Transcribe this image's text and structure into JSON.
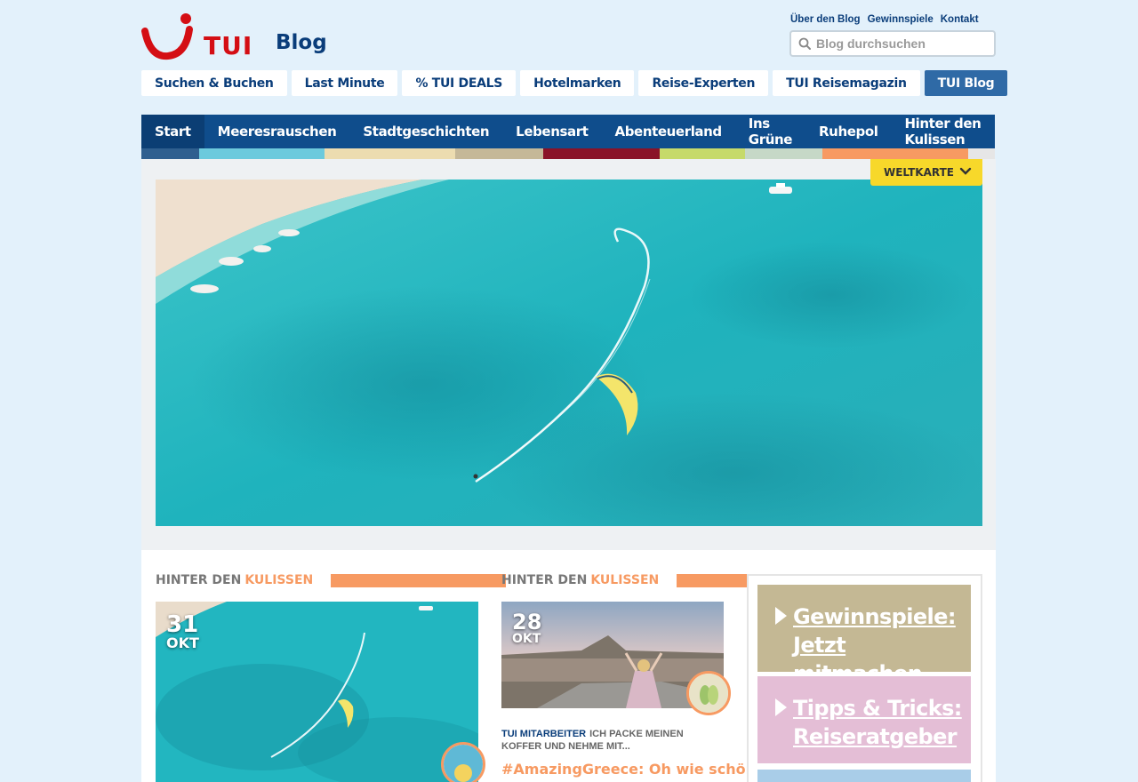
{
  "brand": {
    "logo_text": "TUI",
    "blog_label": "Blog",
    "brand_red": "#d40e14",
    "brand_blue": "#0a3d7a"
  },
  "toplinks": [
    "Über den Blog",
    "Gewinnspiele",
    "Kontakt"
  ],
  "search": {
    "placeholder": "Blog durchsuchen",
    "value": ""
  },
  "topnav": [
    {
      "label": "Suchen & Buchen",
      "active": false
    },
    {
      "label": "Last Minute",
      "active": false
    },
    {
      "label": "% TUI DEALS",
      "active": false
    },
    {
      "label": "Hotelmarken",
      "active": false
    },
    {
      "label": "Reise-Experten",
      "active": false
    },
    {
      "label": "TUI Reisemagazin",
      "active": false
    },
    {
      "label": "TUI Blog",
      "active": true
    }
  ],
  "mainnav": [
    {
      "label": "Start",
      "active": true,
      "color": "#2f5f8f"
    },
    {
      "label": "Meeresrauschen",
      "active": false,
      "color": "#6ccadd"
    },
    {
      "label": "Stadtgeschichten",
      "active": false,
      "color": "#ecdcb0"
    },
    {
      "label": "Lebensart",
      "active": false,
      "color": "#c5b898"
    },
    {
      "label": "Abenteuerland",
      "active": false,
      "color": "#8a1228"
    },
    {
      "label": "Ins Grüne",
      "active": false,
      "color": "#c6da6a"
    },
    {
      "label": "Ruhepol",
      "active": false,
      "color": "#c6d8c7"
    },
    {
      "label": "Hinter den Kulissen",
      "active": false,
      "color": "#f79a62"
    }
  ],
  "weltkarte": {
    "label": "WELTKARTE",
    "color": "#f7d82a"
  },
  "sections": [
    {
      "prefix": "HINTER DEN",
      "highlight": "KULISSEN"
    },
    {
      "prefix": "HINTER DEN",
      "highlight": "KULISSEN"
    }
  ],
  "cards": [
    {
      "day": "31",
      "month": "OKT"
    },
    {
      "day": "28",
      "month": "OKT",
      "category": "TUI MITARBEITER",
      "teaser": "ICH PACKE MEINEN KOFFER UND NEHME MIT...",
      "headline": "#AmazingGreece: Oh wie schön ist"
    }
  ],
  "sidebar": [
    {
      "line1": "Gewinnspiele:",
      "line2": "Jetzt mitmachen",
      "color": "#c4b894"
    },
    {
      "line1": "Tipps & Tricks:",
      "line2": "Reiseratgeber",
      "color": "#e4bed6"
    }
  ],
  "accent_orange": "#f79a62"
}
